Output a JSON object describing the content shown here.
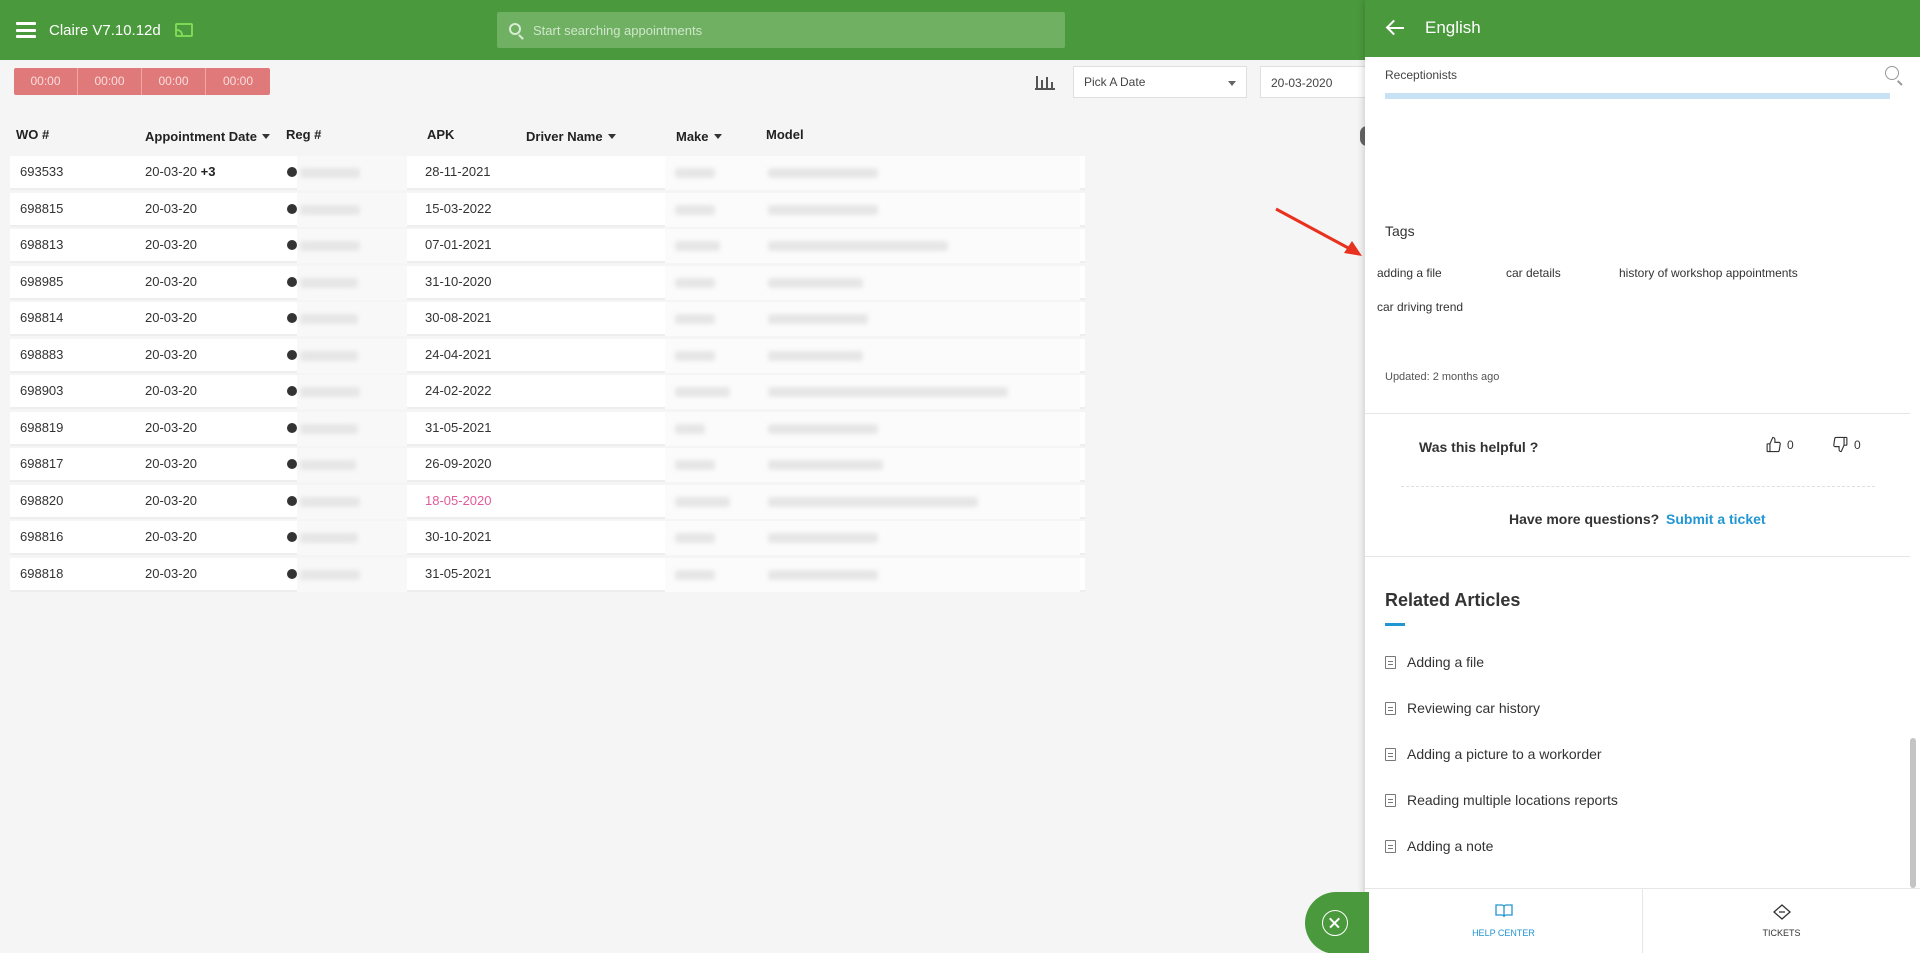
{
  "app": {
    "title": "Claire V7.10.12d",
    "icons": [
      "menu-icon",
      "cast-icon"
    ]
  },
  "search": {
    "placeholder": "Start searching appointments"
  },
  "toolbar": {
    "timers": [
      "00:00",
      "00:00",
      "00:00",
      "00:00"
    ],
    "date_select": "Pick A Date",
    "date_value": "20-03-2020"
  },
  "table": {
    "columns": {
      "wo": "WO #",
      "appointment_date": "Appointment Date",
      "reg": "Reg #",
      "apk": "APK",
      "driver_name": "Driver Name",
      "make": "Make",
      "model": "Model"
    },
    "rows": [
      {
        "wo": "693533",
        "date": "20-03-20",
        "extra": "+3",
        "apk": "28-11-2021",
        "expired": false
      },
      {
        "wo": "698815",
        "date": "20-03-20",
        "extra": "",
        "apk": "15-03-2022",
        "expired": false
      },
      {
        "wo": "698813",
        "date": "20-03-20",
        "extra": "",
        "apk": "07-01-2021",
        "expired": false
      },
      {
        "wo": "698985",
        "date": "20-03-20",
        "extra": "",
        "apk": "31-10-2020",
        "expired": false
      },
      {
        "wo": "698814",
        "date": "20-03-20",
        "extra": "",
        "apk": "30-08-2021",
        "expired": false
      },
      {
        "wo": "698883",
        "date": "20-03-20",
        "extra": "",
        "apk": "24-04-2021",
        "expired": false
      },
      {
        "wo": "698903",
        "date": "20-03-20",
        "extra": "",
        "apk": "24-02-2022",
        "expired": false
      },
      {
        "wo": "698819",
        "date": "20-03-20",
        "extra": "",
        "apk": "31-05-2021",
        "expired": false
      },
      {
        "wo": "698817",
        "date": "20-03-20",
        "extra": "",
        "apk": "26-09-2020",
        "expired": false
      },
      {
        "wo": "698820",
        "date": "20-03-20",
        "extra": "",
        "apk": "18-05-2020",
        "expired": true
      },
      {
        "wo": "698816",
        "date": "20-03-20",
        "extra": "",
        "apk": "30-10-2021",
        "expired": false
      },
      {
        "wo": "698818",
        "date": "20-03-20",
        "extra": "",
        "apk": "31-05-2021",
        "expired": false
      }
    ]
  },
  "panel": {
    "language": "English",
    "breadcrumb": "Receptionists",
    "tags_title": "Tags",
    "tags": [
      "adding a file",
      "car details",
      "history of workshop appointments",
      "car driving trend"
    ],
    "updated": "Updated: 2 months ago",
    "helpful": {
      "question": "Was this helpful ?",
      "up_count": "0",
      "down_count": "0"
    },
    "more_questions": "Have more questions?",
    "submit_ticket": "Submit a ticket",
    "related_title": "Related Articles",
    "related_articles": [
      "Adding a file",
      "Reviewing car history",
      "Adding a picture to a workorder",
      "Reading multiple locations reports",
      "Adding a note"
    ],
    "footer": {
      "help_center": "HELP CENTER",
      "tickets": "TICKETS"
    }
  },
  "colors": {
    "brand_green": "#4a9a3d",
    "timer_red": "#e07a7a",
    "link_blue": "#2196d3",
    "expired_pink": "#e25a9b",
    "annotation_red": "#e8321f"
  }
}
